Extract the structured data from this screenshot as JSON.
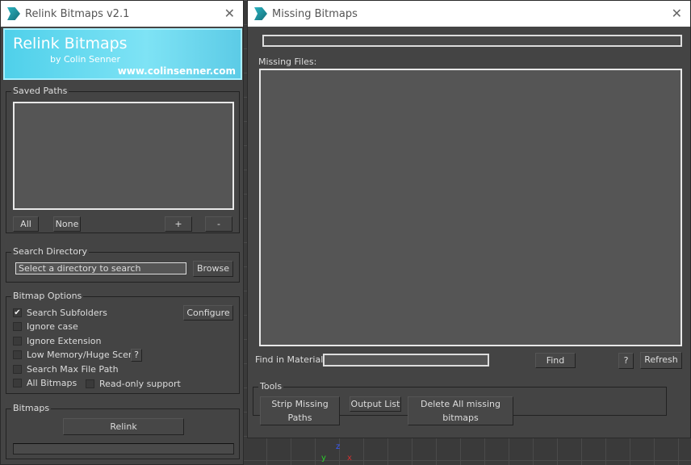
{
  "left": {
    "title": "Relink Bitmaps v2.1",
    "banner": {
      "title": "Relink Bitmaps",
      "author": "by Colin Senner",
      "url": "www.colinsenner.com"
    },
    "saved_paths": {
      "legend": "Saved Paths",
      "all": "All",
      "none": "None",
      "add": "+",
      "remove": "-"
    },
    "search_dir": {
      "legend": "Search Directory",
      "placeholder": "Select a directory to search",
      "browse": "Browse"
    },
    "options": {
      "legend": "Bitmap Options",
      "configure": "Configure",
      "help": "?",
      "search_subfolders": "Search Subfolders",
      "ignore_case": "Ignore case",
      "ignore_ext": "Ignore Extension",
      "low_memory": "Low Memory/Huge Scene",
      "search_max": "Search Max File Path",
      "all_bitmaps": "All Bitmaps",
      "readonly": "Read-only support"
    },
    "bitmaps": {
      "legend": "Bitmaps",
      "relink": "Relink"
    }
  },
  "right": {
    "title": "Missing Bitmaps",
    "missing_files": "Missing Files:",
    "find_in_material": "Find in Material:",
    "find": "Find",
    "help": "?",
    "refresh": "Refresh",
    "tools": {
      "legend": "Tools",
      "strip": "Strip Missing Paths",
      "output": "Output List",
      "delete": "Delete All missing bitmaps"
    }
  },
  "viewport": {
    "axis_z": "z",
    "axis_y": "y",
    "axis_x": "x"
  }
}
